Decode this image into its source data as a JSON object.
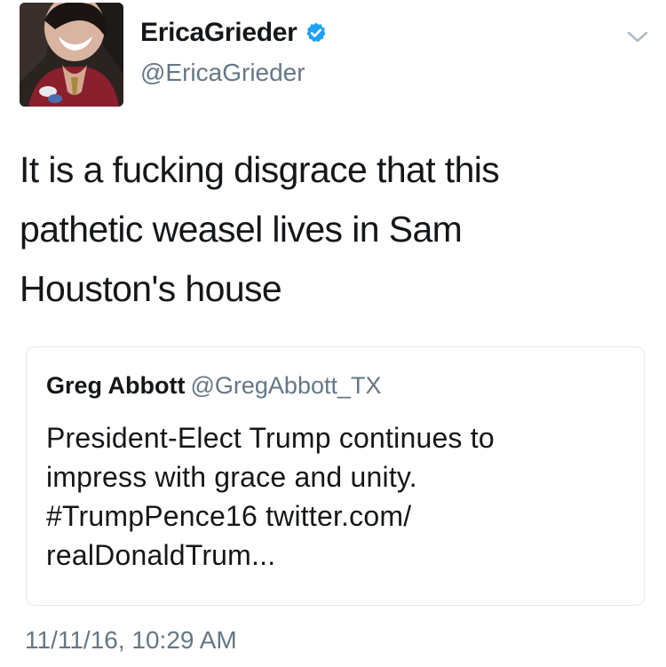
{
  "tweet": {
    "display_name": "EricaGrieder",
    "handle": "@EricaGrieder",
    "verified": true,
    "text": "It is a fucking disgrace that this\npathetic weasel lives in Sam\nHouston's house",
    "timestamp": "11/11/16, 10:29 AM"
  },
  "quoted_tweet": {
    "display_name": "Greg Abbott",
    "handle": "@GregAbbott_TX",
    "text": "President-Elect Trump continues to\nimpress with grace and unity.\n#TrumpPence16 twitter.com/\nrealDonaldTrum..."
  },
  "icons": {
    "verified": "verified-badge-icon",
    "caret": "chevron-down-icon"
  },
  "colors": {
    "verified_blue": "#1da1f2",
    "secondary_text": "#657786",
    "border": "#e1e8ed",
    "primary_text": "#14171a"
  }
}
